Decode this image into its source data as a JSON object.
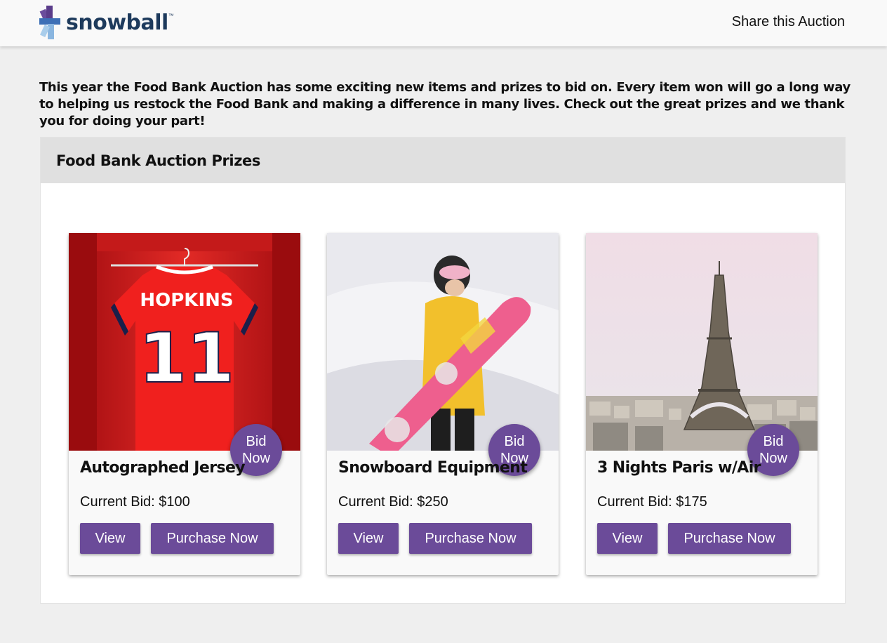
{
  "header": {
    "logo_text": "snowball",
    "logo_tm": "™",
    "share_label": "Share this Auction"
  },
  "intro": {
    "text": "This year the Food Bank Auction has some exciting new items and prizes to bid on. Every item won will go a long way to helping us restock the Food Bank and making a difference in many lives. Check out the great prizes and we thank you for doing your part!"
  },
  "panel": {
    "title": "Food Bank Auction Prizes"
  },
  "cards": [
    {
      "image": "red soccer jersey HOPKINS 11 hanging in locker",
      "jersey_name": "HOPKINS",
      "jersey_number": "11",
      "bid_label": "Bid Now",
      "title": "Autographed Jersey",
      "current_bid": "Current Bid: $100",
      "view_label": "View",
      "purchase_label": "Purchase Now"
    },
    {
      "image": "woman in yellow jacket holding pink snowboard",
      "bid_label": "Bid Now",
      "title": "Snowboard Equipment",
      "current_bid": "Current Bid: $250",
      "view_label": "View",
      "purchase_label": "Purchase Now"
    },
    {
      "image": "Eiffel Tower over Paris skyline",
      "bid_label": "Bid Now",
      "title": "3 Nights Paris w/Air",
      "current_bid": "Current Bid: $175",
      "view_label": "View",
      "purchase_label": "Purchase Now"
    }
  ],
  "colors": {
    "accent": "#6b4b99",
    "header_bg": "#f9f9f9",
    "page_bg": "#efefef",
    "panel_header_bg": "#e0e0e0"
  }
}
